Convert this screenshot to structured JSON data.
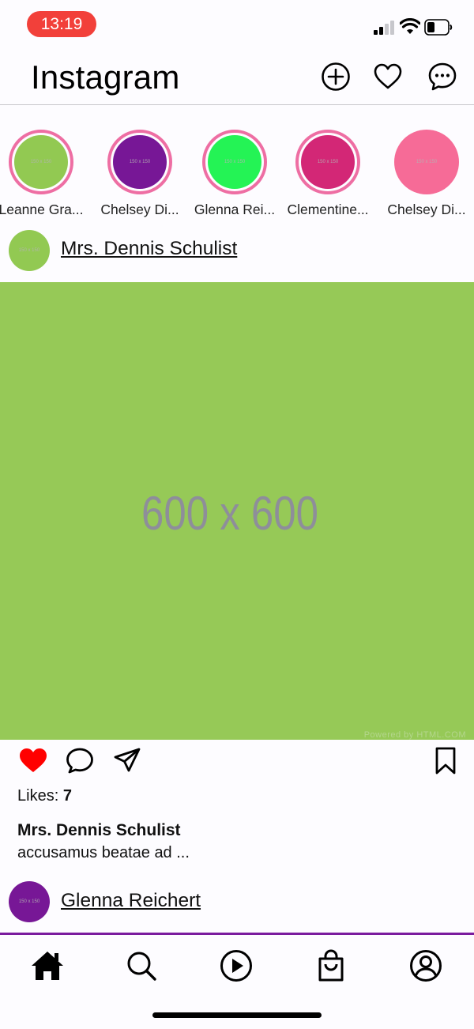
{
  "status_bar": {
    "time": "13:19"
  },
  "header": {
    "logo": "Instagram"
  },
  "stories": [
    {
      "name": "Leanne Gra...",
      "color": "#92c952",
      "ring": true,
      "placeholder": "150 x 150"
    },
    {
      "name": "Chelsey Di...",
      "color": "#771796",
      "ring": true,
      "placeholder": "150 x 150"
    },
    {
      "name": "Glenna Rei...",
      "color": "#24f355",
      "ring": true,
      "placeholder": "150 x 150"
    },
    {
      "name": "Clementine...",
      "color": "#d32776",
      "ring": true,
      "placeholder": "150 x 150"
    },
    {
      "name": "Chelsey Di...",
      "color": "#f66b97",
      "ring": false,
      "placeholder": "150 x 150"
    }
  ],
  "post": {
    "username": "Mrs. Dennis Schulist",
    "avatar_color": "#92c952",
    "avatar_placeholder": "150 x 150",
    "image_label": "600 x 600",
    "image_color": "#92c952",
    "powered_by": "Powered by HTML.COM",
    "likes_label": "Likes:",
    "likes_count": "7",
    "liked": true,
    "caption_user": "Mrs. Dennis Schulist",
    "caption_text": "accusamus beatae ad ..."
  },
  "next_post": {
    "username": "Glenna Reichert",
    "avatar_color": "#771796",
    "avatar_placeholder": "150 x 150"
  },
  "colors": {
    "like_red": "#ff0000",
    "nav_accent": "#7a1b9e",
    "story_ring": "#ee6ea3"
  },
  "icons": {
    "header": [
      "plus-circle-icon",
      "heart-outline-icon",
      "message-bubble-icon"
    ],
    "actions": [
      "heart-filled-icon",
      "comment-icon",
      "send-icon",
      "bookmark-icon"
    ],
    "nav": [
      "home-icon",
      "search-icon",
      "reels-play-icon",
      "shopping-bag-icon",
      "profile-icon"
    ]
  }
}
